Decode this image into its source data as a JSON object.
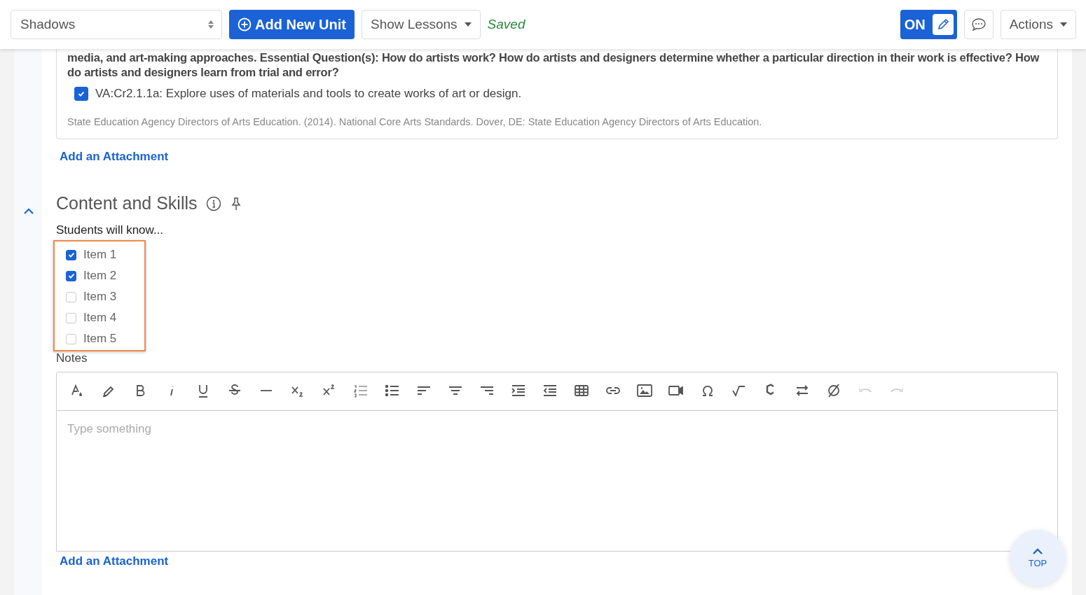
{
  "header": {
    "unit_select": {
      "value": "Shadows"
    },
    "add_button": {
      "label": "Add New Unit"
    },
    "lessons_button": {
      "label": "Show Lessons"
    },
    "save_status": "Saved",
    "edit_toggle": {
      "label": "ON",
      "on": true
    },
    "actions_button": {
      "label": "Actions"
    }
  },
  "standards_card": {
    "text": "media, and art-making approaches. Essential Question(s): How do artists work? How do artists and designers determine whether a particular direction in their work is effective? How do artists and designers learn from trial and error?",
    "standards": [
      {
        "label": "VA:Cr2.1.1a: Explore uses of materials and tools to create works of art or design.",
        "checked": true
      }
    ],
    "citation": "State Education Agency Directors of Arts Education. (2014). National Core Arts Standards. Dover, DE: State Education Agency Directors of Arts Education."
  },
  "attachment_link_1": "Add an Attachment",
  "section": {
    "title": "Content and Skills",
    "expanded": true,
    "prompt": "Students will know...",
    "items": [
      {
        "label": "Item 1",
        "checked": true
      },
      {
        "label": "Item 2",
        "checked": true
      },
      {
        "label": "Item 3",
        "checked": false
      },
      {
        "label": "Item 4",
        "checked": false
      },
      {
        "label": "Item 5",
        "checked": false
      }
    ],
    "notes_label": "Notes",
    "toolbar": [
      {
        "kind": "text-color",
        "disabled": false
      },
      {
        "kind": "highlight",
        "disabled": false
      },
      {
        "kind": "bold",
        "disabled": false
      },
      {
        "kind": "italic",
        "disabled": false
      },
      {
        "kind": "underline",
        "disabled": false
      },
      {
        "kind": "strike",
        "disabled": false
      },
      {
        "kind": "rule",
        "disabled": false
      },
      {
        "kind": "subscript",
        "disabled": false
      },
      {
        "kind": "superscript",
        "disabled": false
      },
      {
        "kind": "ordered-list",
        "disabled": false
      },
      {
        "kind": "bullet-list",
        "disabled": false
      },
      {
        "kind": "align-left",
        "disabled": false
      },
      {
        "kind": "align-center",
        "disabled": false
      },
      {
        "kind": "align-right",
        "disabled": false
      },
      {
        "kind": "indent",
        "disabled": false
      },
      {
        "kind": "outdent",
        "disabled": false
      },
      {
        "kind": "table",
        "disabled": false
      },
      {
        "kind": "link",
        "disabled": false
      },
      {
        "kind": "image",
        "disabled": false
      },
      {
        "kind": "video",
        "disabled": false
      },
      {
        "kind": "special-char",
        "disabled": false
      },
      {
        "kind": "math",
        "disabled": false
      },
      {
        "kind": "chemistry",
        "disabled": false
      },
      {
        "kind": "swap",
        "disabled": false
      },
      {
        "kind": "clear-format",
        "disabled": false
      },
      {
        "kind": "undo",
        "disabled": true
      },
      {
        "kind": "redo",
        "disabled": true
      }
    ],
    "editor": {
      "placeholder": "Type something"
    },
    "attachment_link_2": "Add an Attachment"
  },
  "top_button": {
    "label": "TOP"
  }
}
